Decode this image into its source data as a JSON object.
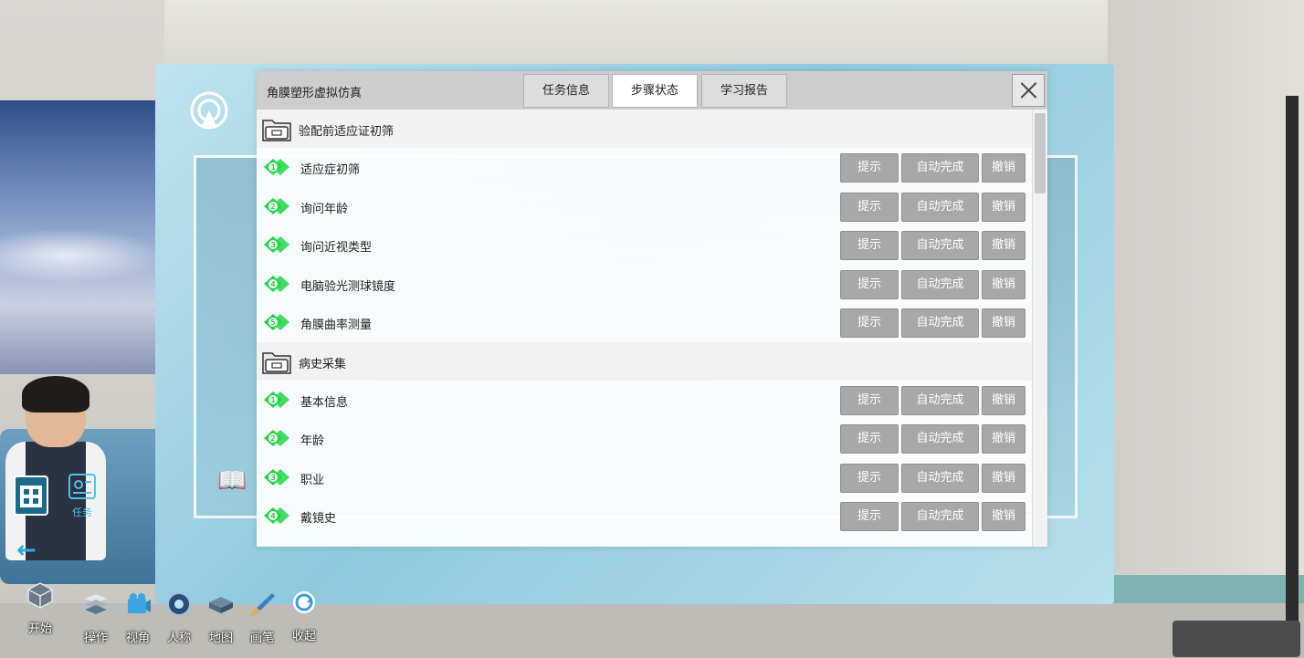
{
  "window": {
    "title": "角膜塑形虚拟仿真"
  },
  "tabs": [
    {
      "label": "任务信息",
      "active": false
    },
    {
      "label": "步骤状态",
      "active": true
    },
    {
      "label": "学习报告",
      "active": false
    }
  ],
  "actions": {
    "hint": "提示",
    "auto_complete": "自动完成",
    "undo": "撤销"
  },
  "groups": [
    {
      "label": "验配前适应证初筛",
      "steps": [
        {
          "number": "1",
          "label": "适应症初筛"
        },
        {
          "number": "2",
          "label": "询问年龄"
        },
        {
          "number": "3",
          "label": "询问近视类型"
        },
        {
          "number": "4",
          "label": "电脑验光测球镜度"
        },
        {
          "number": "5",
          "label": "角膜曲率测量"
        }
      ]
    },
    {
      "label": "病史采集",
      "steps": [
        {
          "number": "1",
          "label": "基本信息"
        },
        {
          "number": "2",
          "label": "年龄"
        },
        {
          "number": "3",
          "label": "职业"
        },
        {
          "number": "4",
          "label": "戴镜史"
        }
      ]
    }
  ],
  "side_panel": {
    "task_label": "任务"
  },
  "toolbar": {
    "items": [
      {
        "label": "开始",
        "icon": "cube-icon"
      },
      {
        "label": "操作",
        "icon": "layers-icon"
      },
      {
        "label": "视角",
        "icon": "camera-icon"
      },
      {
        "label": "人称",
        "icon": "eye-orb-icon"
      },
      {
        "label": "地图",
        "icon": "map-icon"
      },
      {
        "label": "画笔",
        "icon": "brush-icon"
      },
      {
        "label": "收起",
        "icon": "collapse-icon"
      }
    ]
  },
  "colors": {
    "step_tag": "#22d64a",
    "button_bg": "#a8a8a8",
    "panel_bg": "#8fc9dd"
  }
}
